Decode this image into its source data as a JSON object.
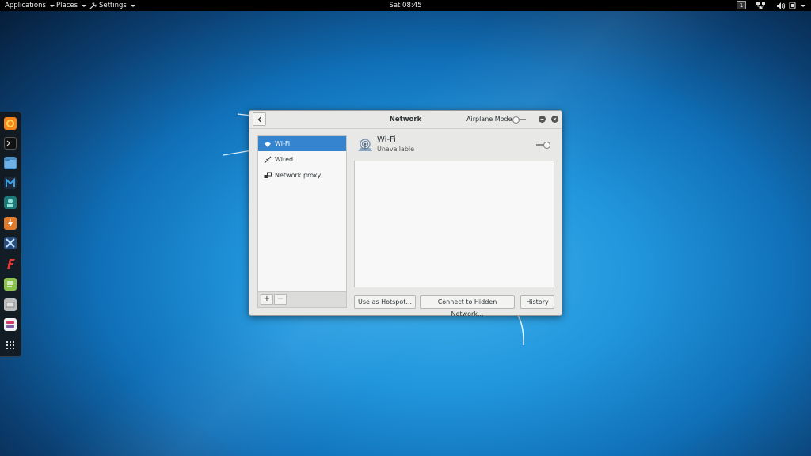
{
  "topbar": {
    "applications": "Applications",
    "places": "Places",
    "settings": "Settings",
    "clock": "Sat 08:45",
    "workspace": "1"
  },
  "dock": {
    "apps": [
      "firefox-icon",
      "terminal-icon",
      "files-icon",
      "metasploit-icon",
      "maltego-icon",
      "burpsuite-icon",
      "armitage-icon",
      "faraday-icon",
      "leafpad-icon",
      "misc-app-icon",
      "settings-tool-icon",
      "show-apps-icon"
    ]
  },
  "window": {
    "title": "Network",
    "airplane_label": "Airplane Mode",
    "sidebar": {
      "items": [
        {
          "label": "Wi-Fi",
          "icon": "wifi-icon",
          "selected": true
        },
        {
          "label": "Wired",
          "icon": "wired-icon",
          "selected": false
        },
        {
          "label": "Network proxy",
          "icon": "proxy-icon",
          "selected": false
        }
      ],
      "add": "+",
      "remove": "−"
    },
    "wifi": {
      "name": "Wi-Fi",
      "status": "Unavailable"
    },
    "buttons": {
      "hotspot": "Use as Hotspot...",
      "hidden": "Connect to Hidden Network...",
      "history": "History"
    }
  },
  "colors": {
    "accent": "#3584d0",
    "topbar": "#000000",
    "window_bg": "#e8e8e7"
  }
}
